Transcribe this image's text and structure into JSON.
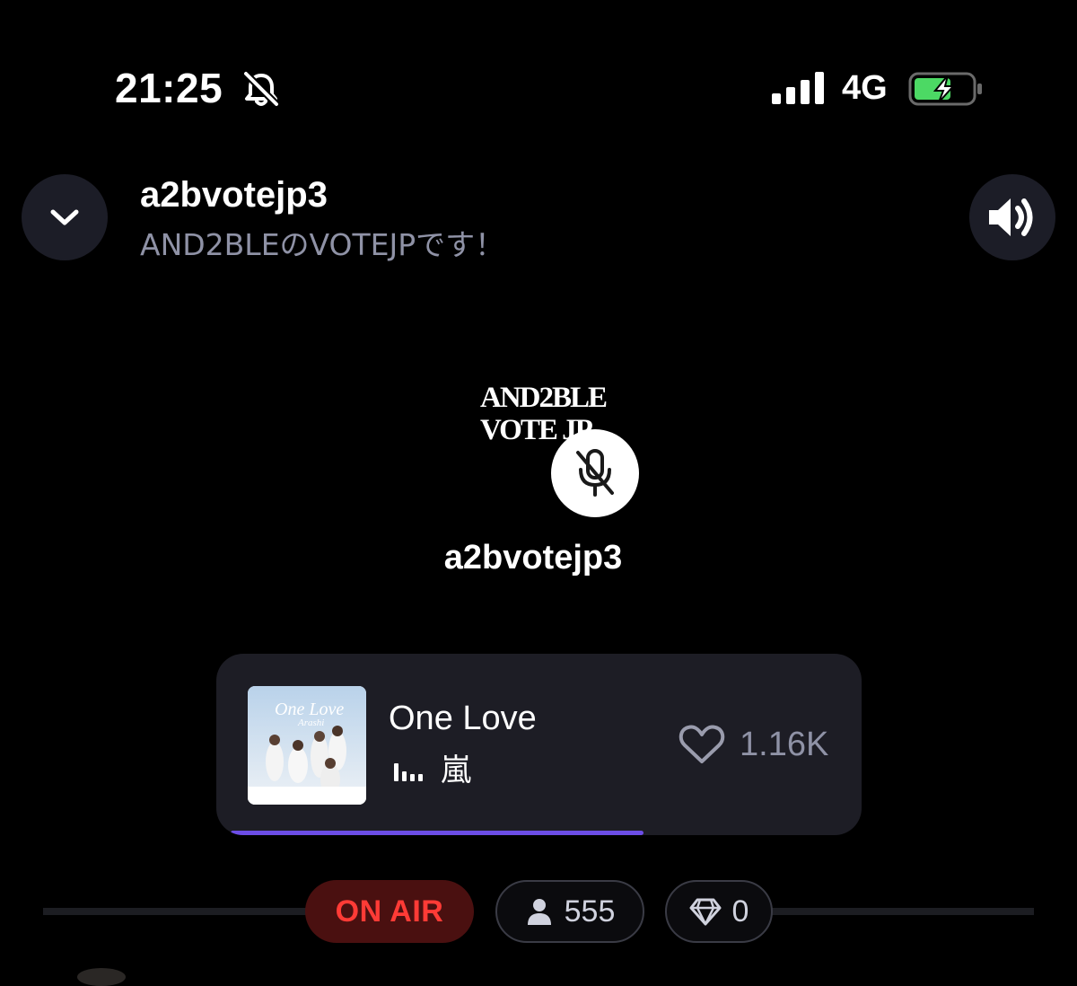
{
  "status_bar": {
    "time": "21:25",
    "network": "4G",
    "silent_icon": "bell-slash-icon",
    "signal_icon": "cellular-signal-icon",
    "battery_icon": "battery-charging-icon",
    "battery_color": "#4cd964"
  },
  "header": {
    "title": "a2bvotejp3",
    "subtitle": "AND2BLEのVOTEJPです！",
    "back_icon": "chevron-down-icon",
    "sound_icon": "speaker-icon"
  },
  "host": {
    "logo_line1": "AND2BLE",
    "logo_line2": "VOTE JP",
    "name": "a2bvotejp3",
    "mic_state_icon": "mic-off-icon"
  },
  "music": {
    "title": "One Love",
    "artist": "嵐",
    "art_line1": "One Love",
    "art_line2": "Arashi",
    "likes": "1.16K",
    "progress": 0.67,
    "accent": "#6c4de6"
  },
  "stats": {
    "on_air": "ON AIR",
    "listeners": "555",
    "gems": "0",
    "on_air_color": "#ff3b36"
  }
}
